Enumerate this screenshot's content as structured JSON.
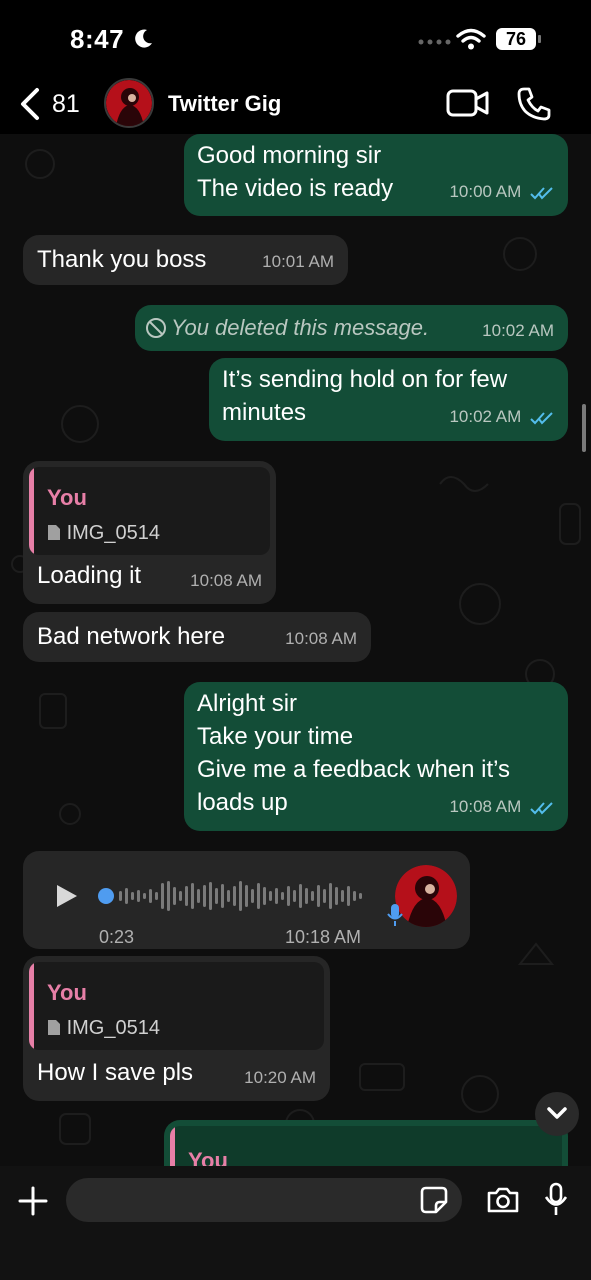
{
  "status_bar": {
    "time": "8:47",
    "battery": "76",
    "icons": [
      "moon-icon",
      "signal-dots-icon",
      "wifi-icon",
      "battery-icon"
    ]
  },
  "header": {
    "back_count": "81",
    "title": "Twitter Gig",
    "icons": [
      "chevron-left-icon",
      "avatar",
      "video-camera-icon",
      "phone-icon"
    ]
  },
  "messages": [
    {
      "direction": "out",
      "lines": [
        "Good morning sir",
        "The video is ready"
      ],
      "time": "10:00 AM",
      "read": true
    },
    {
      "direction": "in",
      "lines": [
        "Thank you boss"
      ],
      "time": "10:01 AM"
    },
    {
      "direction": "out",
      "deleted": true,
      "text": "You deleted this message.",
      "time": "10:02 AM"
    },
    {
      "direction": "out",
      "lines": [
        "It’s sending hold on for few",
        "minutes"
      ],
      "time": "10:02 AM",
      "read": true
    },
    {
      "direction": "in",
      "reply_to": {
        "name": "You",
        "file": "IMG_0514"
      },
      "lines": [
        "Loading it"
      ],
      "time": "10:08 AM"
    },
    {
      "direction": "in",
      "lines": [
        "Bad network here"
      ],
      "time": "10:08 AM"
    },
    {
      "direction": "out",
      "lines": [
        "Alright sir",
        "Take your time",
        "Give me a feedback when it’s",
        "loads up"
      ],
      "time": "10:08 AM",
      "read": true
    },
    {
      "direction": "in",
      "voice": {
        "duration": "0:23",
        "progress": 0.0
      },
      "time": "10:18 AM"
    },
    {
      "direction": "in",
      "reply_to": {
        "name": "You",
        "file": "IMG_0514"
      },
      "lines": [
        "How I save pls"
      ],
      "time": "10:20 AM"
    },
    {
      "direction": "out",
      "reply_to": {
        "name": "You"
      },
      "partial": true
    }
  ],
  "composer": {
    "placeholder": "",
    "icons": [
      "plus-icon",
      "sticker-icon",
      "camera-icon",
      "microphone-icon"
    ]
  },
  "colors": {
    "outgoing_bubble": "#134d37",
    "incoming_bubble": "#262626",
    "quote_accent": "#e77fa7",
    "read_ticks": "#53bdeb"
  }
}
